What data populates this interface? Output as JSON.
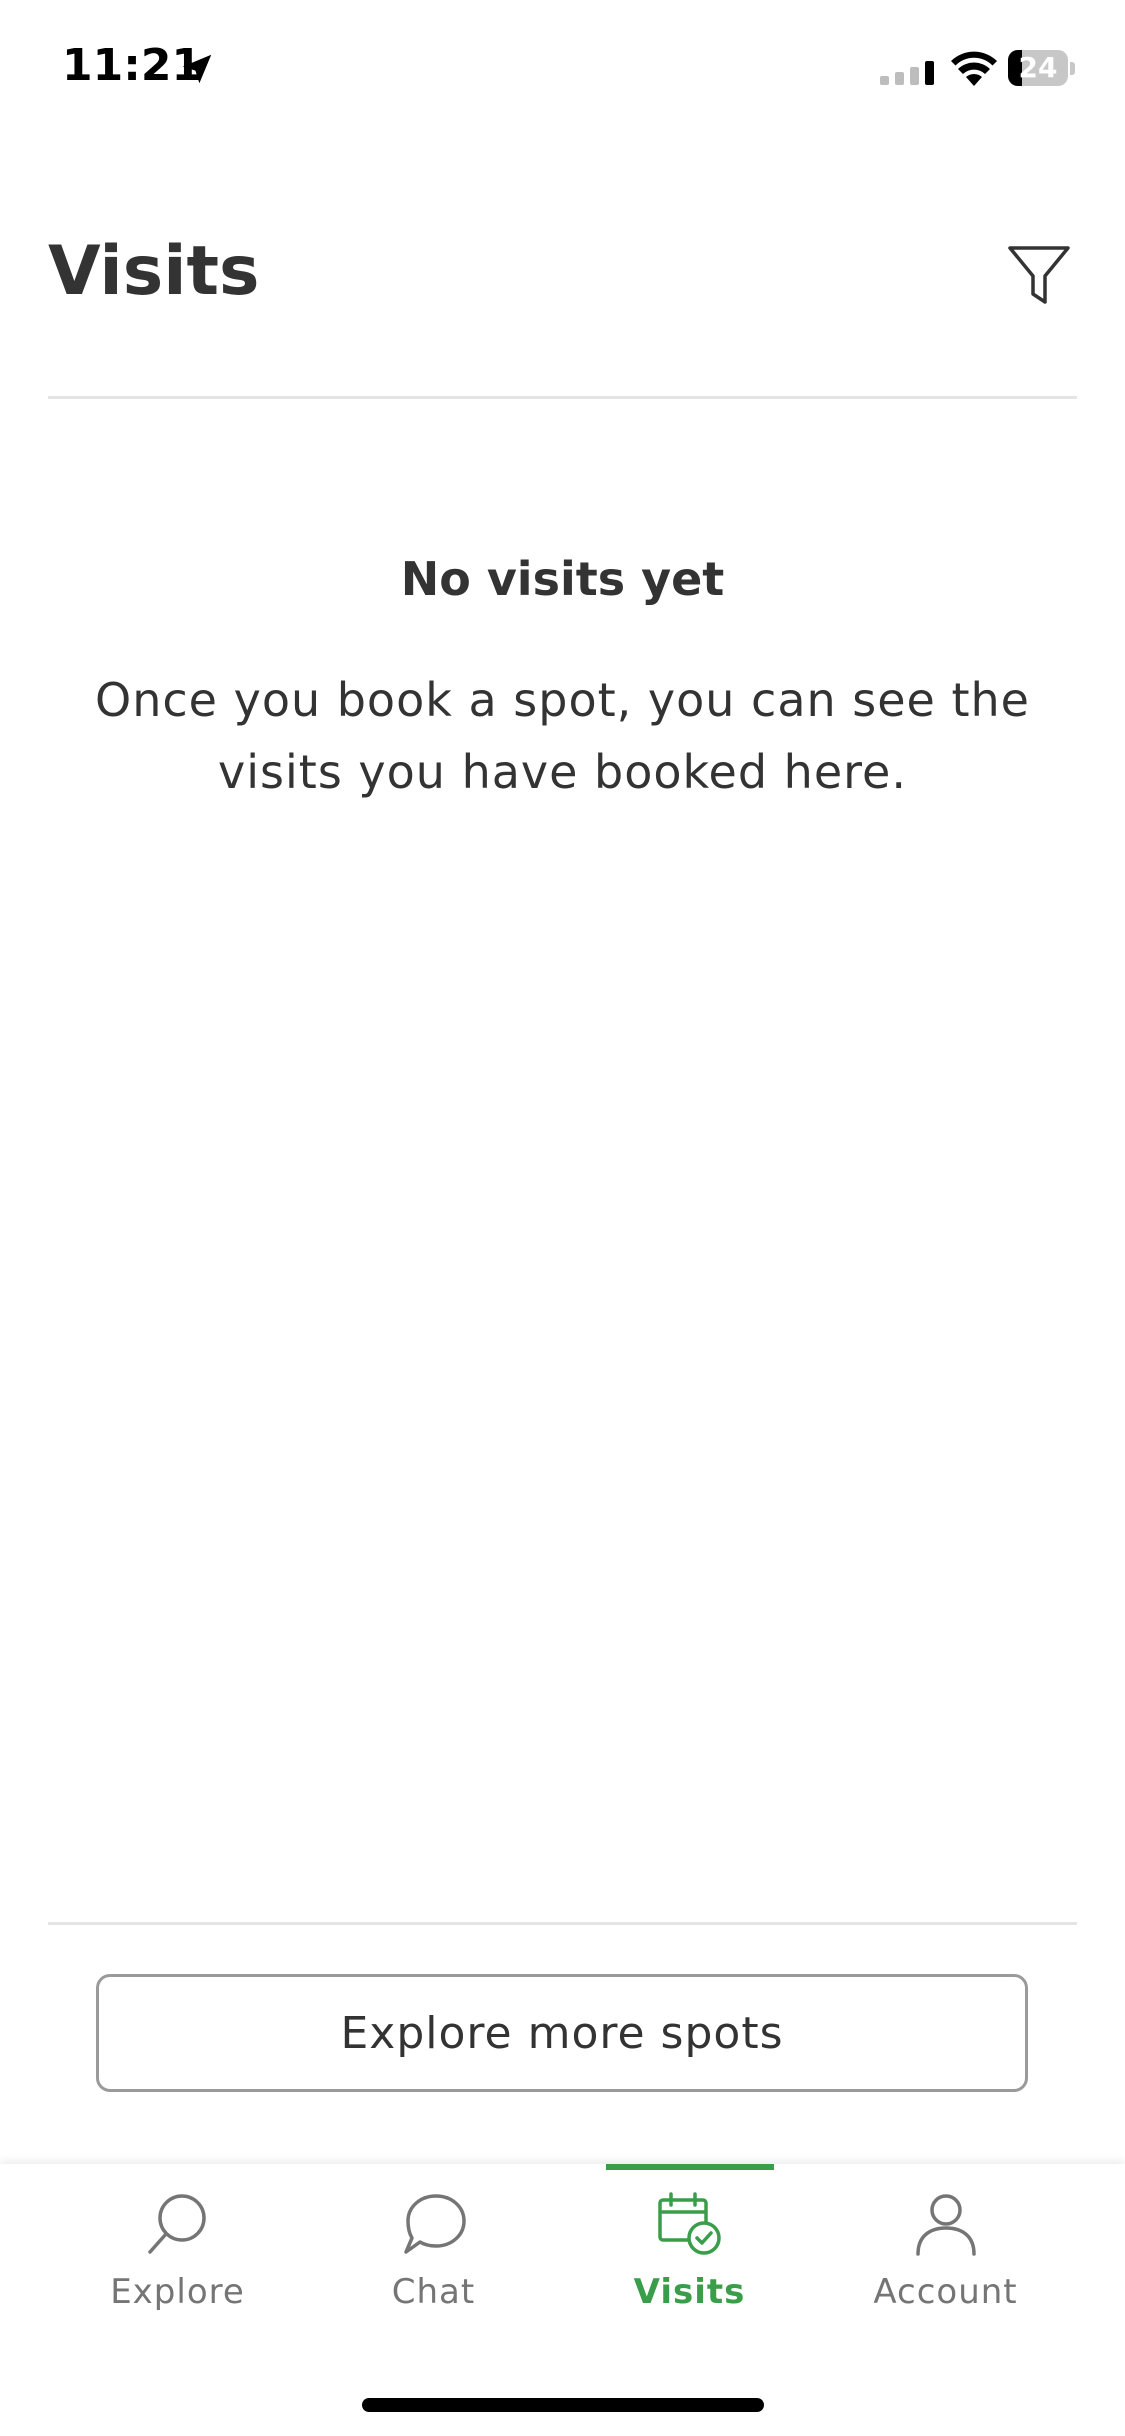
{
  "status_bar": {
    "time": "11:21",
    "battery": "24",
    "battery_level": 0.24
  },
  "header": {
    "title": "Visits",
    "filter_icon": "filter-icon"
  },
  "empty_state": {
    "title": "No visits yet",
    "message": "Once you book a spot, you can see the visits you have booked here."
  },
  "cta": {
    "label": "Explore more spots"
  },
  "tabs": [
    {
      "label": "Explore",
      "icon": "search-icon",
      "active": false
    },
    {
      "label": "Chat",
      "icon": "chat-bubble-icon",
      "active": false
    },
    {
      "label": "Visits",
      "icon": "calendar-check-icon",
      "active": true
    },
    {
      "label": "Account",
      "icon": "user-icon",
      "active": false
    }
  ],
  "colors": {
    "accent": "#3a9d4a",
    "text": "#333333",
    "inactive": "#757575",
    "divider": "#e4e4e4"
  }
}
